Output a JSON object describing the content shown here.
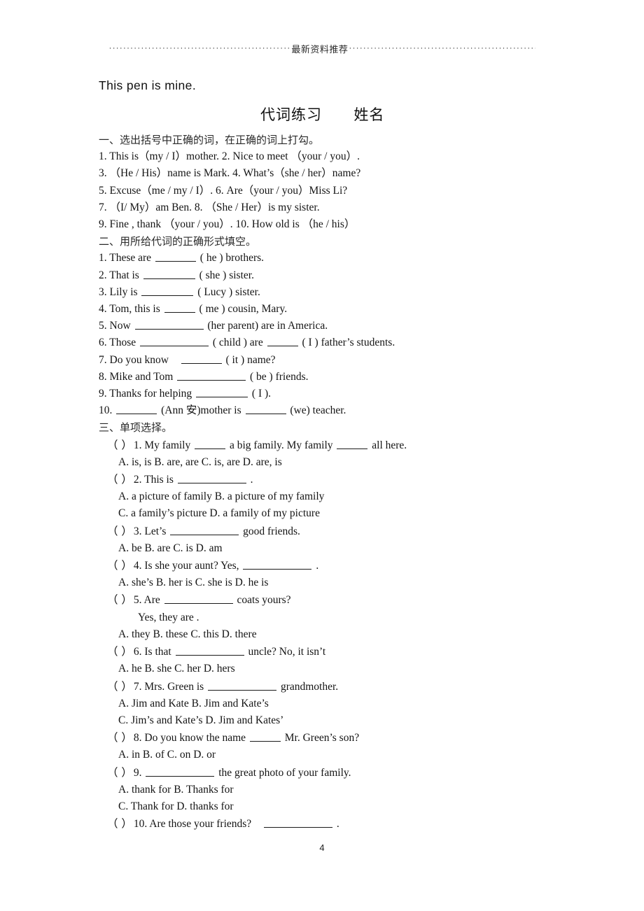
{
  "header": {
    "title": "最新资料推荐",
    "dots_left": "····················································································",
    "dots_right": "······················································································"
  },
  "headline": "This pen is mine.",
  "subject": {
    "title": "代词练习",
    "name_label": "姓名"
  },
  "sections": [
    {
      "id": "section-one",
      "heading": "一、选出括号中正确的词，在正确的词上打勾。",
      "lines": [
        "1. This is（my / I）mother.    2. Nice to meet  （your / you）.",
        "3. （He / His）name is Mark.   4. What’s（she / her）name?",
        "5. Excuse（me / my / I）.       6. Are（your / you）Miss Li?",
        "7. （I/ My）am Ben.           8. （She / Her）is my sister.",
        "9. Fine , thank  （your / you）.  10. How old is  （he / his）"
      ]
    },
    {
      "id": "section-two",
      "heading": "二、用所给代词的正确形式填空。",
      "items": [
        {
          "pre": "1. These are",
          "blank": "b-md",
          "post": "( he ) brothers."
        },
        {
          "pre": "2. That is",
          "blank": "b-lg",
          "post": "( she ) sister."
        },
        {
          "pre": "3. Lily is",
          "blank": "b-lg",
          "post": "( Lucy ) sister."
        },
        {
          "pre": "4. Tom, this is",
          "blank": "b-sm",
          "post": "( me ) cousin, Mary."
        },
        {
          "pre": "5. Now",
          "blank": "b-xl",
          "post": "(her parent)   are in America."
        },
        {
          "pre": "6. Those",
          "blank": "b-xl",
          "post": "( child ) are",
          "blank2": "b-sm",
          "post2": "( I ) father’s students."
        },
        {
          "pre": "7. Do you know",
          "blank": "b-md",
          "post": "( it ) name?"
        },
        {
          "pre": "8. Mike and Tom",
          "blank": "b-xl",
          "post": "( be ) friends."
        },
        {
          "pre": "9. Thanks for helping",
          "blank": "b-lg",
          "post": "( I )."
        },
        {
          "pre": "10.",
          "blank": "b-md",
          "post": "(Ann 安)mother is",
          "blank2": "b-md",
          "post2": "(we) teacher."
        }
      ]
    },
    {
      "id": "section-three",
      "heading": "三、单项选择。",
      "questions": [
        {
          "paren": "（  ）",
          "stem_pre": "1. My family",
          "blank": "b-sm",
          "stem_mid": "a big family. My family",
          "blank2": "b-sm",
          "stem_post": "all here.",
          "choice_rows": [
            "A. is, is    B. are, are   C. is, are D. are, is"
          ]
        },
        {
          "paren": "（  ）",
          "stem_pre": "2. This is",
          "blank": "b-xl",
          "stem_post": ".",
          "choice_rows": [
            "A. a picture of family     B. a picture of my family",
            "C. a family’s picture     D. a family of my picture"
          ]
        },
        {
          "paren": "（  ）",
          "stem_pre": "3. Let’s",
          "blank": "b-xl",
          "stem_post": "good friends.",
          "choice_rows": [
            "A. be    B. are   C. is    D. am"
          ]
        },
        {
          "paren": "（  ）",
          "stem_pre": "4. Is she your aunt? Yes,",
          "blank": "b-xl",
          "stem_post": ".",
          "choice_rows": [
            "A. she’s    B. her is    C. she is    D. he is"
          ]
        },
        {
          "paren": "（  ）",
          "stem_pre": "5. Are",
          "blank": "b-xl",
          "stem_post": "coats yours?",
          "extra_line": "Yes, they are .",
          "choice_rows": [
            "A. they    B. these    C. this    D. there"
          ]
        },
        {
          "paren": "（  ）",
          "stem_pre": "6. Is that",
          "blank": "b-xl",
          "stem_post": "uncle? No, it isn’t",
          "choice_rows": [
            "A. he   B. she   C. her   D. hers"
          ]
        },
        {
          "paren": "（  ）",
          "stem_pre": "7. Mrs. Green is",
          "blank": "b-xl",
          "stem_post": "grandmother.",
          "choice_rows": [
            "A. Jim and Kate     B. Jim and Kate’s",
            "C. Jim’s and Kate’s    D. Jim and Kates’"
          ]
        },
        {
          "paren": "（  ）",
          "stem_pre": "8. Do you know the name",
          "blank": "b-sm",
          "stem_post": "Mr. Green’s son?",
          "choice_rows": [
            "A. in    B. of    C. on    D. or"
          ]
        },
        {
          "paren": "（  ）",
          "stem_pre": "9.",
          "blank": "b-xl",
          "stem_post": "the great photo of your family.",
          "choice_rows": [
            "A. thank for    B. Thanks for",
            "C. Thank for    D. thanks for"
          ]
        },
        {
          "paren": "（  ）",
          "stem_pre": "10. Are those your friends?",
          "blank": "b-xl",
          "stem_post": ".",
          "choice_rows": []
        }
      ]
    }
  ],
  "footer": {
    "page_number": "4"
  }
}
